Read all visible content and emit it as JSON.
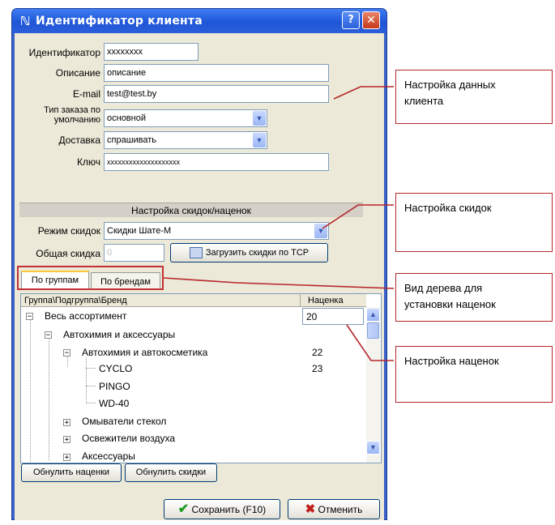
{
  "window": {
    "title": "Идентификатор клиента",
    "help_icon": "?",
    "close_icon": "✕"
  },
  "client": {
    "id_label": "Идентификатор",
    "id_value": "xxxxxxxx",
    "desc_label": "Описание",
    "desc_value": "описание",
    "email_label": "E-mail",
    "email_value": "test@test.by",
    "order_type_label_1": "Тип заказа по",
    "order_type_label_2": "умолчанию",
    "order_type_value": "основной",
    "delivery_label": "Доставка",
    "delivery_value": "спрашивать",
    "key_label": "Ключ",
    "key_value": "xxxxxxxxxxxxxxxxxxxx"
  },
  "discounts": {
    "section_title": "Настройка скидок/наценок",
    "mode_label": "Режим скидок",
    "mode_value": "Скидки Шате-М",
    "total_label": "Общая скидка",
    "total_value": "0",
    "load_button": "Загрузить скидки по TCP"
  },
  "tabs": [
    {
      "label": "По группам",
      "active": true
    },
    {
      "label": "По брендам",
      "active": false
    }
  ],
  "tree": {
    "col_group": "Группа\\Подгруппа\\Бренд",
    "col_markup": "Наценка",
    "rows": [
      {
        "label": "Весь ассортимент",
        "value": "20"
      },
      {
        "label": "Автохимия и аксессуары",
        "value": ""
      },
      {
        "label": "Автохимия и автокосметика",
        "value": "22"
      },
      {
        "label": "CYCLO",
        "value": "23"
      },
      {
        "label": "PINGO",
        "value": ""
      },
      {
        "label": "WD-40",
        "value": ""
      },
      {
        "label": "Омыватели стекол",
        "value": ""
      },
      {
        "label": "Освежители воздуха",
        "value": ""
      },
      {
        "label": "Аксессуары",
        "value": ""
      }
    ]
  },
  "buttons": {
    "reset_markups": "Обнулить наценки",
    "reset_discounts": "Обнулить скидки",
    "save": "Сохранить (F10)",
    "cancel": "Отменить"
  },
  "callouts": {
    "client_data_1": "Настройка данных",
    "client_data_2": "клиента",
    "discounts": "Настройка скидок",
    "tree_view_1": "Вид дерева для",
    "tree_view_2": "установки наценок",
    "markups": "Настройка наценок"
  },
  "colors": {
    "titlebar": "#2a5fd9",
    "dialog_bg": "#ece9d8",
    "callout_border": "#b5262a"
  }
}
